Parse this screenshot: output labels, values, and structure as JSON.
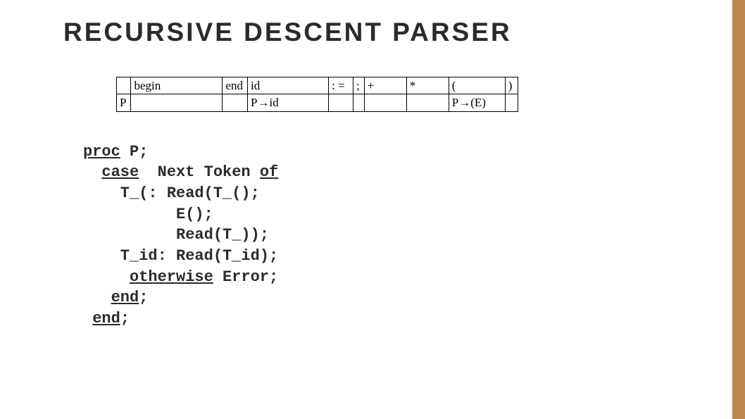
{
  "title": "RECURSIVE DESCENT PARSER",
  "table": {
    "headers": {
      "blank": "",
      "begin": "begin",
      "end": "end",
      "id": "id",
      "assign": ": =",
      "semi": ";",
      "plus": "+",
      "star": "*",
      "lparen": "(",
      "rparen": ")"
    },
    "row": {
      "label": "P",
      "begin": "",
      "end": "",
      "id": "P→id",
      "assign": "",
      "semi": "",
      "plus": "",
      "star": "",
      "lparen": "P→(E)",
      "rparen": ""
    }
  },
  "code": {
    "kw_proc": "proc",
    "p_name": " P;",
    "kw_case": "case",
    "next_token": "  Next Token ",
    "kw_of": "of",
    "line_tlparen": "    T_(: Read(T_();",
    "line_e": "          E();",
    "line_trparen": "          Read(T_));",
    "line_tid": "    T_id: Read(T_id);",
    "kw_otherwise": "otherwise",
    "error": " Error;",
    "kw_end1": "end",
    "semi1": ";",
    "kw_end2": "end",
    "semi2": ";"
  }
}
